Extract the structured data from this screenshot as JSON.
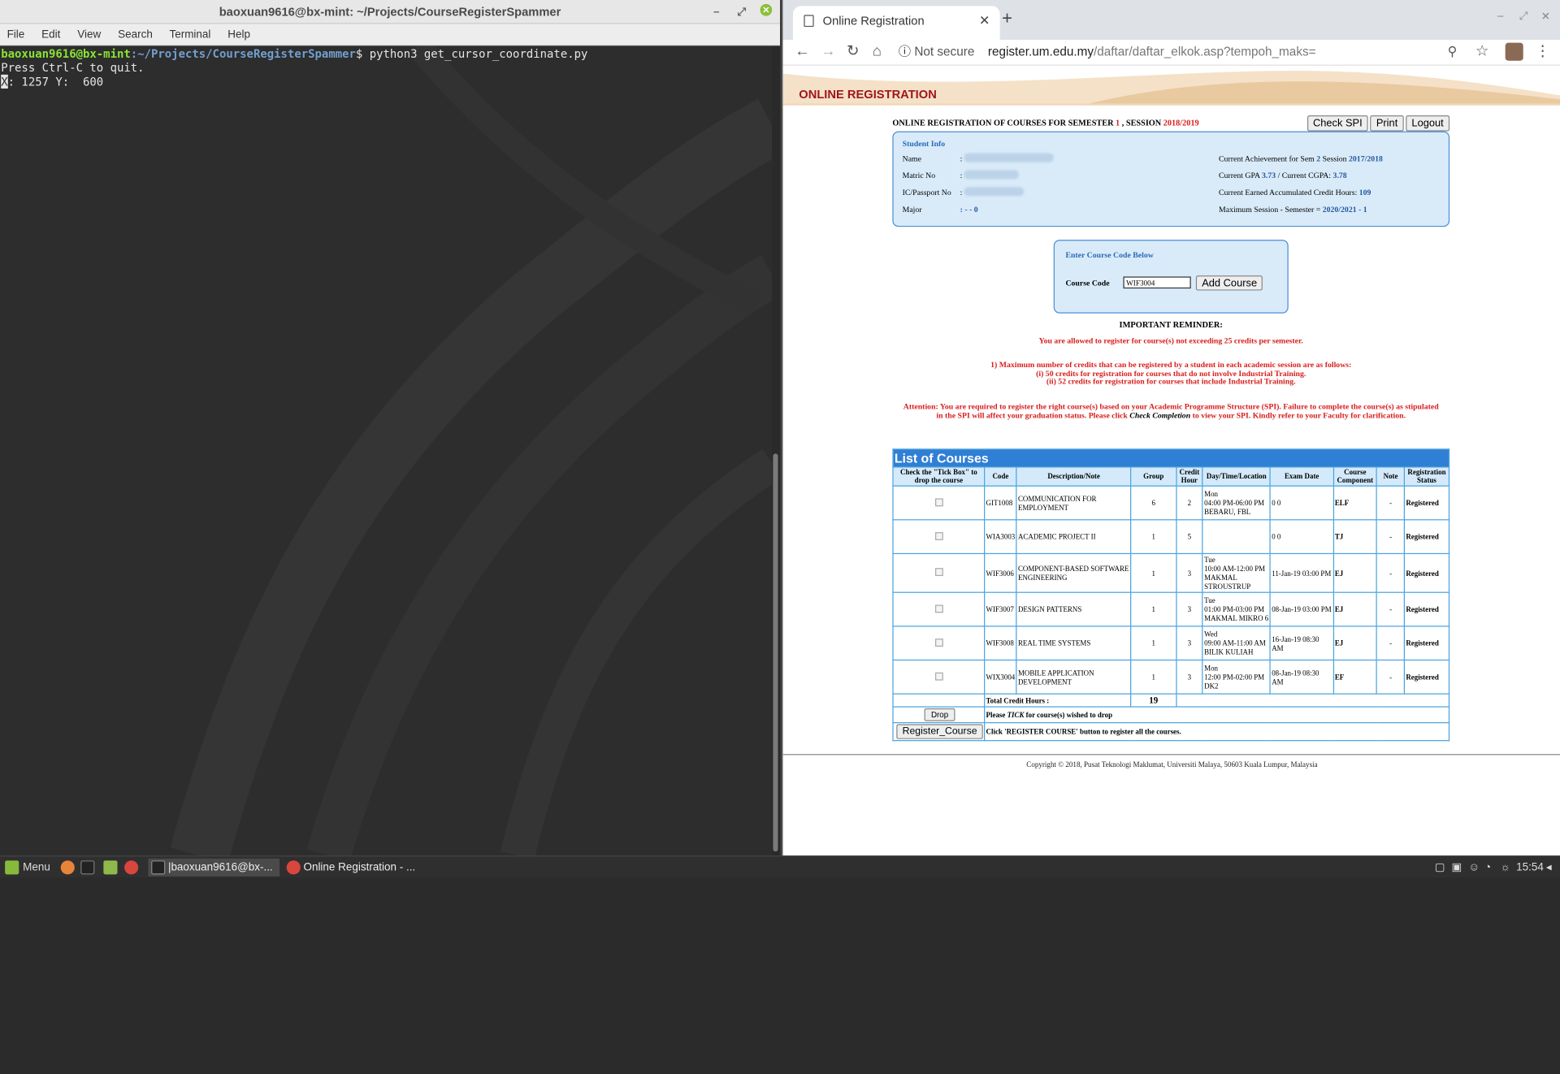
{
  "terminal": {
    "title": "baoxuan9616@bx-mint: ~/Projects/CourseRegisterSpammer",
    "menu": [
      "File",
      "Edit",
      "View",
      "Search",
      "Terminal",
      "Help"
    ],
    "prompt_user": "baoxuan9616@bx-mint",
    "prompt_path": ":~/Projects/CourseRegisterSpammer",
    "prompt_command": "$ python3 get_cursor_coordinate.py",
    "line2": "Press Ctrl-C to quit.",
    "line3_cursor": "X",
    "line3_rest": ": 1257 Y:  600"
  },
  "browser": {
    "tab_title": "Online Registration",
    "not_secure": "Not secure",
    "url_host": "register.um.edu.my",
    "url_path": "/daftar/daftar_elkok.asp?tempoh_maks="
  },
  "page": {
    "header": "ONLINE REGISTRATION",
    "sem_prefix": "ONLINE REGISTRATION OF COURSES FOR SEMESTER ",
    "semester": "1",
    "sem_mid": " , SESSION ",
    "session": "2018/2019",
    "buttons": {
      "check_spi": "Check SPI",
      "print": "Print",
      "logout": "Logout"
    },
    "student_info": {
      "title": "Student Info",
      "name_label": "Name",
      "matric_label": "Matric No",
      "ic_label": "IC/Passport  No",
      "major_label": "Major",
      "colon": ":",
      "major_value": ": - - 0",
      "achievement_prefix": "Current Achievement for Sem ",
      "achievement_sem": "2",
      "achievement_mid": " Session ",
      "achievement_session": "2017/2018",
      "gpa_prefix": "Current GPA ",
      "gpa": "3.73",
      "cgpa_prefix": " / Current CGPA: ",
      "cgpa": "3.78",
      "credit_prefix": "Current Earned Accumulated Credit Hours: ",
      "credit": "109",
      "max_prefix": "Maximum Session - Semester = ",
      "max_value": "2020/2021 - 1"
    },
    "course_entry": {
      "title": "Enter Course Code Below",
      "label": "Course Code",
      "value": "WIF3004",
      "button": "Add Course"
    },
    "reminder": {
      "title": "IMPORTANT REMINDER:",
      "line1": "You are allowed to register for course(s) not exceeding 25 credits per semester.",
      "line2": "1) Maximum number of credits that can be registered by a student in each academic session are as follows:",
      "line3": "(i) 50 credits for registration for courses that do not involve Industrial Training.",
      "line4": "(ii) 52 credits for registration for courses that include Industrial Training.",
      "line5": "Attention: You are required to register the right course(s) based on your Academic Programme Structure (SPI). Failure to complete the course(s) as stipulated",
      "line6a": "in the SPI will affect your graduation status. Please click ",
      "line6b": "Check Completion",
      "line6c": " to view your SPI. Kindly refer to your Faculty for clarification."
    },
    "courses": {
      "title": "List of Courses",
      "headers": [
        "Check the \"Tick Box\" to drop the course",
        "Code",
        "Description/Note",
        "Group",
        "Credit Hour",
        "Day/Time/Location",
        "Exam Date",
        "Course Component",
        "Note",
        "Registration Status"
      ],
      "rows": [
        {
          "code": "GIT1008",
          "desc": "COMMUNICATION FOR EMPLOYMENT",
          "group": "6",
          "credit": "2",
          "dtl1": "Mon",
          "dtl2": "04:00 PM-06:00 PM",
          "dtl3": "BEBARU, FBL",
          "exam": "0 0",
          "comp": "ELF",
          "note": "-",
          "status": "Registered"
        },
        {
          "code": "WIA3003",
          "desc": "ACADEMIC PROJECT II",
          "group": "1",
          "credit": "5",
          "dtl1": "",
          "dtl2": "",
          "dtl3": "",
          "exam": "0 0",
          "comp": "TJ",
          "note": "-",
          "status": "Registered"
        },
        {
          "code": "WIF3006",
          "desc": "COMPONENT-BASED SOFTWARE ENGINEERING",
          "group": "1",
          "credit": "3",
          "dtl1": "Tue",
          "dtl2": "10:00 AM-12:00 PM",
          "dtl3": "MAKMAL STROUSTRUP",
          "exam": "11-Jan-19 03:00 PM",
          "comp": "EJ",
          "note": "-",
          "status": "Registered"
        },
        {
          "code": "WIF3007",
          "desc": "DESIGN PATTERNS",
          "group": "1",
          "credit": "3",
          "dtl1": "Tue",
          "dtl2": "01:00 PM-03:00 PM",
          "dtl3": "MAKMAL MIKRO 6",
          "exam": "08-Jan-19 03:00 PM",
          "comp": "EJ",
          "note": "-",
          "status": "Registered"
        },
        {
          "code": "WIF3008",
          "desc": "REAL TIME SYSTEMS",
          "group": "1",
          "credit": "3",
          "dtl1": "Wed",
          "dtl2": "09:00 AM-11:00 AM",
          "dtl3": "BILIK KULIAH",
          "exam": "16-Jan-19 08:30 AM",
          "comp": "EJ",
          "note": "-",
          "status": "Registered"
        },
        {
          "code": "WIX3004",
          "desc": "MOBILE APPLICATION DEVELOPMENT",
          "group": "1",
          "credit": "3",
          "dtl1": "Mon",
          "dtl2": "12:00 PM-02:00 PM",
          "dtl3": "DK2",
          "exam": "08-Jan-19 08:30 AM",
          "comp": "EF",
          "note": "-",
          "status": "Registered"
        }
      ],
      "total_label": "Total Credit Hours :",
      "total_value": "19",
      "drop_button": "Drop",
      "drop_text_a": "Please ",
      "drop_text_b": "TICK",
      "drop_text_c": " for course(s) wished to drop",
      "register_button": "Register_Course",
      "register_text": "Click 'REGISTER COURSE' button to register all the courses."
    },
    "copyright": "Copyright © 2018, Pusat Teknologi Maklumat, Universiti Malaya, 50603 Kuala Lumpur, Malaysia"
  },
  "taskbar": {
    "menu": "Menu",
    "task1": "|baoxuan9616@bx-...",
    "task2": "Online Registration - ...",
    "time": "15:54"
  }
}
